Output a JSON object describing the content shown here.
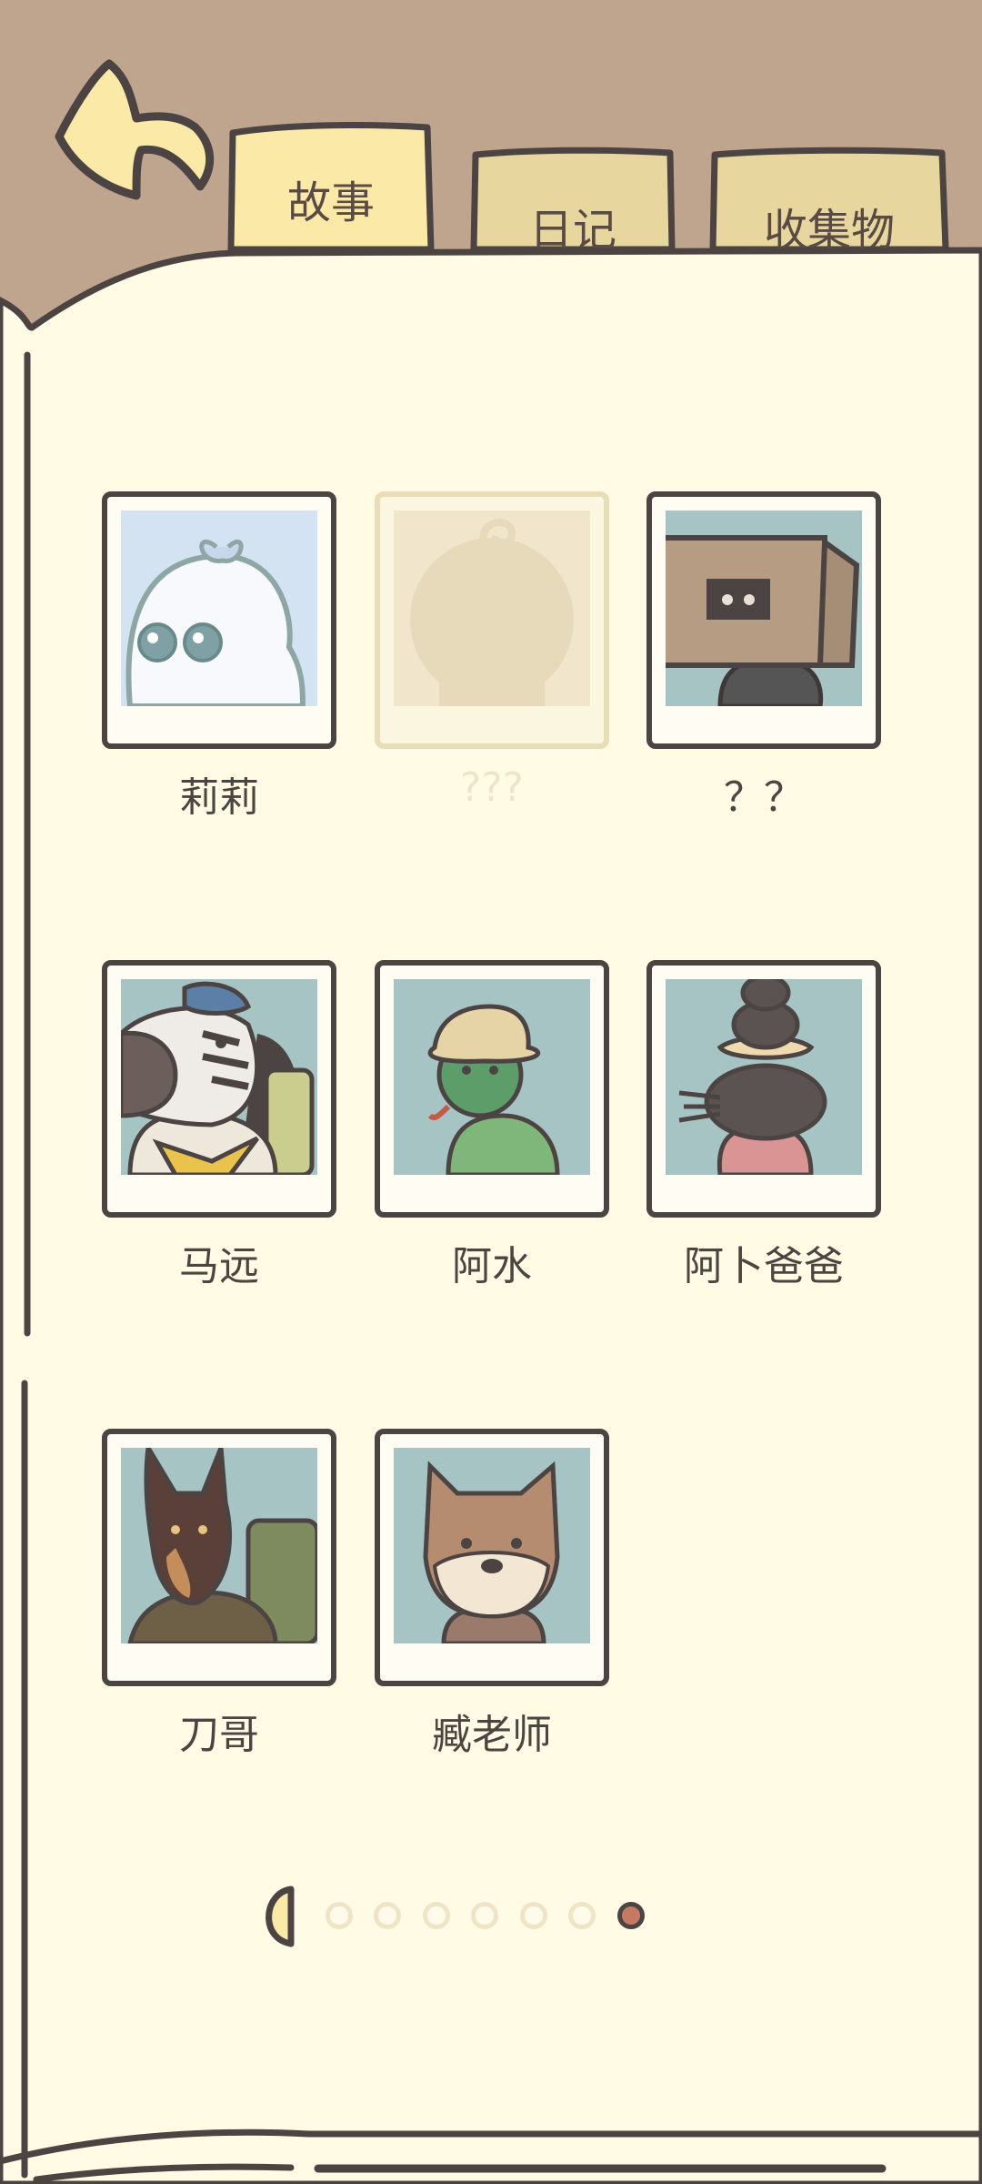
{
  "tabs": [
    {
      "label": "故事",
      "active": true
    },
    {
      "label": "日记",
      "active": false
    },
    {
      "label": "收集物",
      "active": false
    }
  ],
  "characters": [
    {
      "name": "莉莉",
      "locked": false,
      "portrait": "ghost-lily-portrait"
    },
    {
      "name": "???",
      "locked": true,
      "portrait": "unknown-silhouette-portrait"
    },
    {
      "name": "？？",
      "locked": false,
      "portrait": "box-creature-portrait"
    },
    {
      "name": "马远",
      "locked": false,
      "portrait": "zebra-portrait"
    },
    {
      "name": "阿水",
      "locked": false,
      "portrait": "green-frog-hat-portrait"
    },
    {
      "name": "阿卜爸爸",
      "locked": false,
      "portrait": "mole-stack-portrait"
    },
    {
      "name": "刀哥",
      "locked": false,
      "portrait": "doberman-portrait"
    },
    {
      "name": "臧老师",
      "locked": false,
      "portrait": "shiba-dog-portrait"
    }
  ],
  "pager": {
    "total": 7,
    "current": 7
  },
  "icons": {
    "back": "back-arrow-icon",
    "prev": "prev-page-icon"
  },
  "colors": {
    "background": "#BFA58D",
    "paper": "#FFFBE4",
    "outline": "#4C4442",
    "active_tab": "#FBE9A8",
    "inactive_tab": "#E7D79E",
    "portrait_bg": "#A7C4C4",
    "active_dot": "#C67A62"
  }
}
